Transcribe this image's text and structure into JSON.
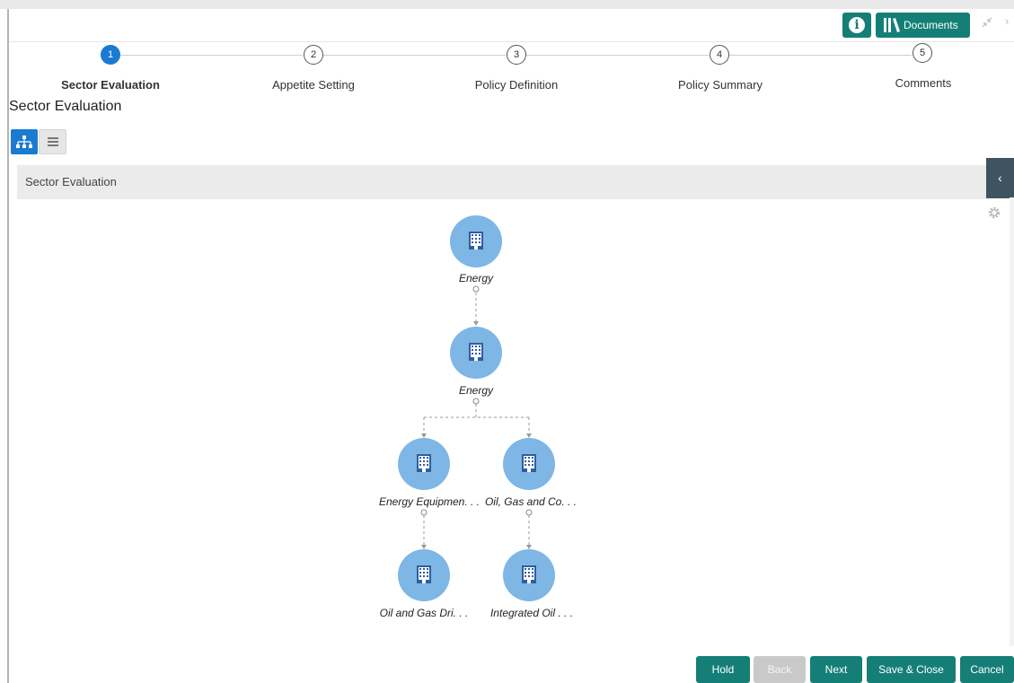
{
  "header": {
    "info_icon": "info-icon",
    "documents_label": "Documents",
    "documents_icon": "library-icon",
    "colors": {
      "accent": "#157f77",
      "active_step": "#1b7ad1"
    }
  },
  "stepper": {
    "steps": [
      {
        "number": "1",
        "label": "Sector Evaluation",
        "active": true
      },
      {
        "number": "2",
        "label": "Appetite Setting",
        "active": false
      },
      {
        "number": "3",
        "label": "Policy Definition",
        "active": false
      },
      {
        "number": "4",
        "label": "Policy Summary",
        "active": false
      },
      {
        "number": "5",
        "label": "Comments",
        "active": false
      }
    ]
  },
  "main": {
    "title": "Sector Evaluation",
    "view_toggle": {
      "tree_icon": "hierarchy-icon",
      "list_icon": "list-icon"
    },
    "panel_title": "Sector Evaluation",
    "tree": {
      "node_icon": "building-icon",
      "node_color": "#7eb6e6",
      "nodes": [
        {
          "label": "Energy"
        },
        {
          "label": "Energy"
        },
        {
          "label": "Energy Equipmen. . ."
        },
        {
          "label": "Oil, Gas and Co. . ."
        },
        {
          "label": "Oil and Gas Dri. . ."
        },
        {
          "label": "Integrated Oil . . ."
        }
      ]
    }
  },
  "footer": {
    "buttons": [
      {
        "label": "Hold",
        "enabled": true
      },
      {
        "label": "Back",
        "enabled": false
      },
      {
        "label": "Next",
        "enabled": true
      },
      {
        "label": "Save & Close",
        "enabled": true
      },
      {
        "label": "Cancel",
        "enabled": true
      }
    ]
  }
}
